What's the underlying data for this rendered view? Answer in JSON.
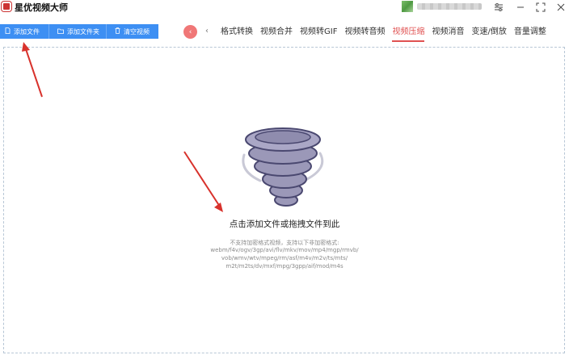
{
  "app": {
    "title": "星优视频大师"
  },
  "window": {
    "menu_icon": "sliders-icon",
    "minimize_icon": "minimize-icon",
    "maximize_icon": "maximize-icon",
    "close_icon": "close-icon"
  },
  "toolbar": {
    "buttons": [
      {
        "label": "添加文件",
        "icon": "file-icon"
      },
      {
        "label": "添加文件夹",
        "icon": "folder-icon"
      },
      {
        "label": "清空视频",
        "icon": "trash-icon"
      }
    ]
  },
  "tabs": {
    "items": [
      "格式转换",
      "视频合并",
      "视频转GIF",
      "视频转音频",
      "视频压缩",
      "视频消音",
      "变速/倒放",
      "音量调整"
    ],
    "active": "视频压缩"
  },
  "dropzone": {
    "title": "点击添加文件或拖拽文件到此",
    "note_lines": [
      "不支持加密格式视频，支持以下非加密格式:",
      "webm/f4v/ogv/3gp/avi/flv/mkv/mov/mp4/mgp/rmvb/",
      "vob/wmv/wtv/mpeg/rm/asf/m4v/m2v/ts/mts/",
      "m2t/m2ts/dv/mxf/mpg/3gpp/aif/mod/m4s"
    ]
  },
  "colors": {
    "accent_blue": "#3d8ff3",
    "active_red": "#e05252",
    "annotation_red": "#d8322c"
  }
}
